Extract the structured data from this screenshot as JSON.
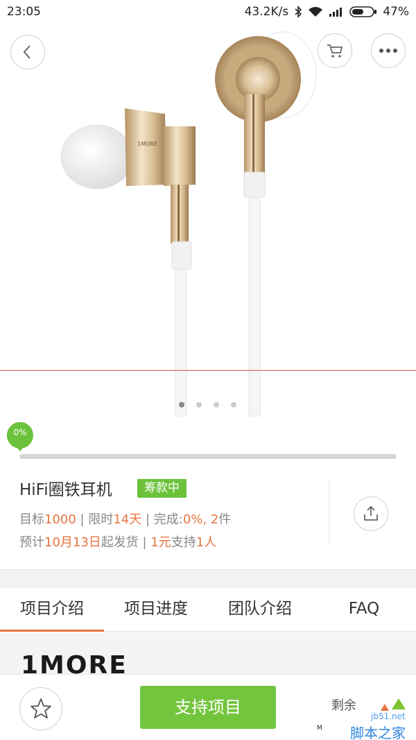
{
  "status_bar": {
    "time": "23:05",
    "network_speed": "43.2K/s",
    "battery_percent": "47%",
    "icons": [
      "bluetooth-icon",
      "wifi-icon",
      "signal-icon",
      "battery-icon"
    ]
  },
  "hero": {
    "back_icon": "chevron-left-icon",
    "cart_icon": "cart-icon",
    "more_icon": "more-dots-icon",
    "image_brand_text": "1MORE",
    "carousel": {
      "count": 4,
      "active_index": 0
    }
  },
  "progress": {
    "label": "0%",
    "fraction": 0.0
  },
  "product": {
    "title": "HiFi圈铁耳机",
    "status_tag": "筹款中",
    "goal_label": "目标",
    "goal_value": "1000",
    "sep1": " | ",
    "limit_label": "限时",
    "limit_value": "14天",
    "sep2": " | ",
    "done_label": "完成:",
    "done_value": "0%, ",
    "pieces_value": "2",
    "pieces_unit": "件",
    "ship_label": "预计",
    "ship_date": "10月13日",
    "ship_suffix": "起发货",
    "sep3": " | ",
    "price_value": "1元",
    "supporters_label": "支持",
    "supporters_value": "1人",
    "share_icon": "share-icon"
  },
  "tabs": [
    {
      "label": "项目介绍",
      "active": true
    },
    {
      "label": "项目进度",
      "active": false
    },
    {
      "label": "团队介绍",
      "active": false
    },
    {
      "label": "FAQ",
      "active": false
    }
  ],
  "content": {
    "brand_logo": "1MORE"
  },
  "bottom_bar": {
    "favorite_icon": "star-icon",
    "support_label": "支持项目",
    "remaining_label": "剩余"
  },
  "watermark": {
    "url": "jb51.net",
    "text": "脚本之家",
    "corner_letter": "M"
  },
  "colors": {
    "accent_green": "#74c53e",
    "accent_orange": "#e6743f",
    "tab_underline": "#e6743f"
  }
}
